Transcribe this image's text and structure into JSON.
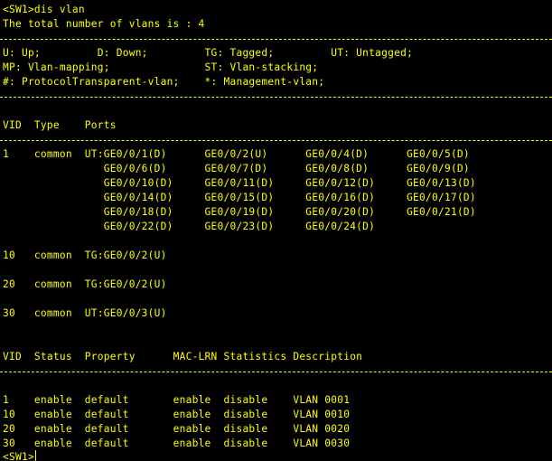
{
  "terminal": {
    "fg_color": "#ffff00",
    "bg_color": "#000000",
    "command_line": "<SW1>dis vlan",
    "total_line": "The total number of vlans is : 4",
    "legend": [
      "U: Up;         D: Down;         TG: Tagged;         UT: Untagged;",
      "MP: Vlan-mapping;               ST: Vlan-stacking;",
      "#: ProtocolTransparent-vlan;    *: Management-vlan;"
    ],
    "ports_header": "VID  Type    Ports",
    "ports_rows": [
      "1    common  UT:GE0/0/1(D)      GE0/0/2(U)      GE0/0/4(D)      GE0/0/5(D)",
      "                GE0/0/6(D)      GE0/0/7(D)      GE0/0/8(D)      GE0/0/9(D)",
      "                GE0/0/10(D)     GE0/0/11(D)     GE0/0/12(D)     GE0/0/13(D)",
      "                GE0/0/14(D)     GE0/0/15(D)     GE0/0/16(D)     GE0/0/17(D)",
      "                GE0/0/18(D)     GE0/0/19(D)     GE0/0/20(D)     GE0/0/21(D)",
      "                GE0/0/22(D)     GE0/0/23(D)     GE0/0/24(D)",
      "",
      "10   common  TG:GE0/0/2(U)",
      "",
      "20   common  TG:GE0/0/2(U)",
      "",
      "30   common  UT:GE0/0/3(U)"
    ],
    "status_header": "VID  Status  Property      MAC-LRN Statistics Description",
    "status_rows": [
      "1    enable  default       enable  disable    VLAN 0001",
      "10   enable  default       enable  disable    VLAN 0010",
      "20   enable  default       enable  disable    VLAN 0020",
      "30   enable  default       enable  disable    VLAN 0030"
    ],
    "prompt": "<SW1>"
  }
}
